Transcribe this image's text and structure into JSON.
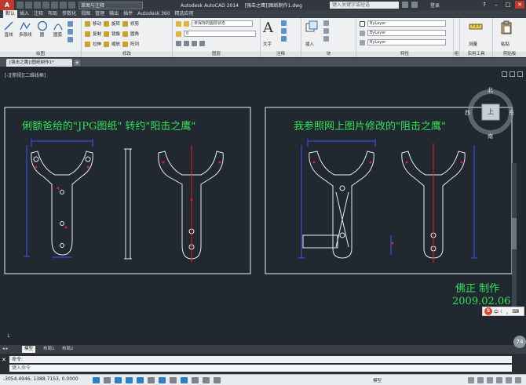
{
  "titlebar": {
    "logo": "A",
    "workspace": "草图与注释",
    "app_name": "Autodesk AutoCAD 2014",
    "file_name": "[强击之鹰]]图纸制作1.dwg",
    "search_placeholder": "键入关键字或短语",
    "user": "登录",
    "help": "?"
  },
  "ribbon_tabs": [
    "默认",
    "插入",
    "注释",
    "布局",
    "参数化",
    "视图",
    "管理",
    "输出",
    "插件",
    "Autodesk 360",
    "精选应用"
  ],
  "ribbon": {
    "draw_group": "绘图",
    "draw_tools": [
      "直线",
      "多段线",
      "圆",
      "圆弧"
    ],
    "modify_group": "修改",
    "modify_rows": [
      [
        "移动",
        "旋转",
        "修剪"
      ],
      [
        "复制",
        "镜像",
        "圆角"
      ],
      [
        "拉伸",
        "缩放",
        "阵列"
      ]
    ],
    "layers_group": "图层",
    "layer_state": "未保存的图层状态",
    "annotation_group": "注释",
    "annotation_text": "文字",
    "block_group": "块",
    "block_insert": "插入",
    "properties_group": "特性",
    "prop_values": [
      "ByLayer",
      "ByLayer",
      "ByLayer"
    ],
    "groups_group": "组",
    "utilities_group": "实用工具",
    "measure_label": "测量",
    "clipboard_group": "剪贴板",
    "paste_label": "粘贴"
  },
  "document_tab": "[强击之鹰]]图纸制作1*",
  "viewport": {
    "label": "[-][俯视][二维线框]",
    "drawing_notes": {
      "left_title": "俐额爸给的\"JPG图纸\" 转约\"阳击之鹰\"",
      "right_title": "我参照网上图片修改的\"阻击之鹰\"",
      "author": "佛正 制作",
      "date": "2009.02.06"
    },
    "viewcube": {
      "north": "北",
      "south": "南",
      "east": "东",
      "west": "西",
      "top": "上"
    },
    "ime": {
      "logo": "S",
      "lang": "中"
    },
    "badge": "74"
  },
  "layout_tabs": [
    "模型",
    "布局1",
    "布局2"
  ],
  "command": {
    "history": "命令:",
    "prompt": "键入命令"
  },
  "status": {
    "coords": "-3054.4946, 1388.7153, 0.0000",
    "right_text": "模型"
  },
  "colors": {
    "viewport_bg": "#212830",
    "drawing_text": "#33e05a",
    "dimension_blue": "#3a52ff",
    "centerline_red": "#e02020",
    "outline_white": "#e8eef2"
  }
}
